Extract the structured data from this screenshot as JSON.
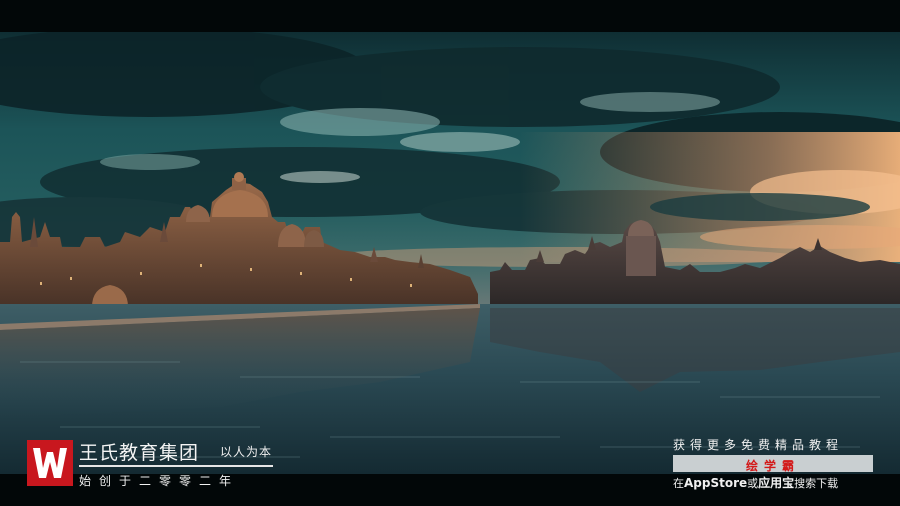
{
  "brand": {
    "name": "王氏教育集团",
    "slogan": "以人为本",
    "founded": "始创于二零零二年"
  },
  "promo": {
    "title": "获得更多免费精品教程",
    "app_name": "绘学霸",
    "line_prefix": "在",
    "store": "AppStore",
    "line_or": "或",
    "store2": "应用宝",
    "line_suffix": "搜索下载"
  },
  "colors": {
    "sky_teal": "#1d5558",
    "sunset": "#e0a070",
    "water": "#2a4a54",
    "brand_red": "#c8171e",
    "app_red": "#d31a1a"
  },
  "icons": [
    "brand-w-logo-icon"
  ]
}
